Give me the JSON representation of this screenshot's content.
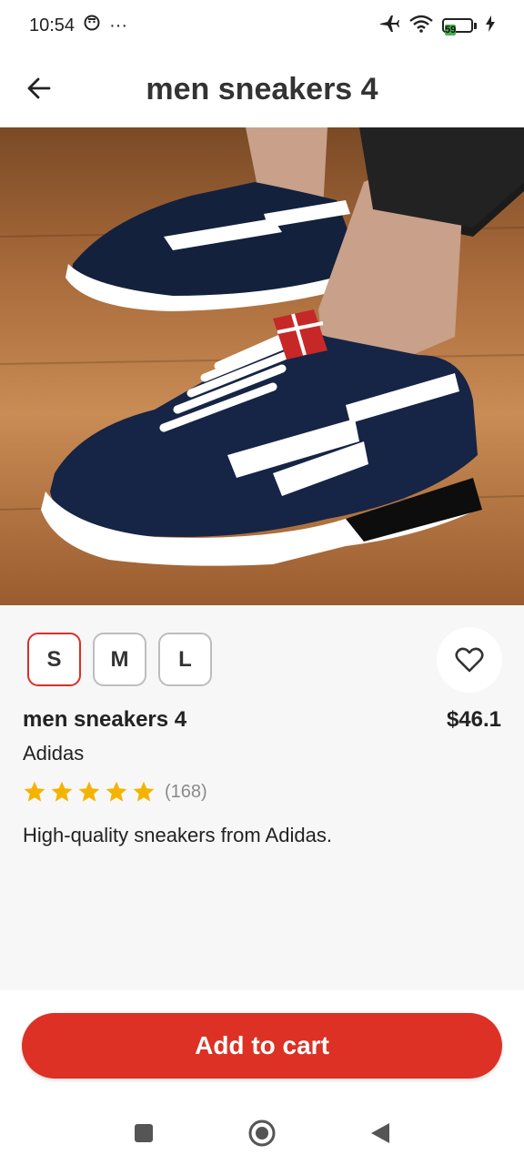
{
  "status_bar": {
    "time": "10:54",
    "more": "···",
    "battery_level": "59",
    "battery_fraction": 0.59
  },
  "app_bar": {
    "title": "men sneakers 4"
  },
  "product": {
    "image_alt": "navy and white men sneakers",
    "sizes": [
      {
        "label": "S",
        "selected": true
      },
      {
        "label": "M",
        "selected": false
      },
      {
        "label": "L",
        "selected": false
      }
    ],
    "name": "men sneakers 4",
    "price": "$46.1",
    "brand": "Adidas",
    "rating": 5,
    "review_count": "(168)",
    "description": "High-quality sneakers from Adidas."
  },
  "actions": {
    "add_to_cart": "Add to cart"
  },
  "colors": {
    "accent": "#dc3124",
    "star": "#f5b301",
    "selected_border": "#d93025"
  },
  "icons": [
    "back-arrow-icon",
    "heart-icon",
    "star-icon",
    "airplane-icon",
    "wifi-icon",
    "battery-icon",
    "charging-icon",
    "nav-square-icon",
    "nav-circle-icon",
    "nav-back-icon"
  ]
}
